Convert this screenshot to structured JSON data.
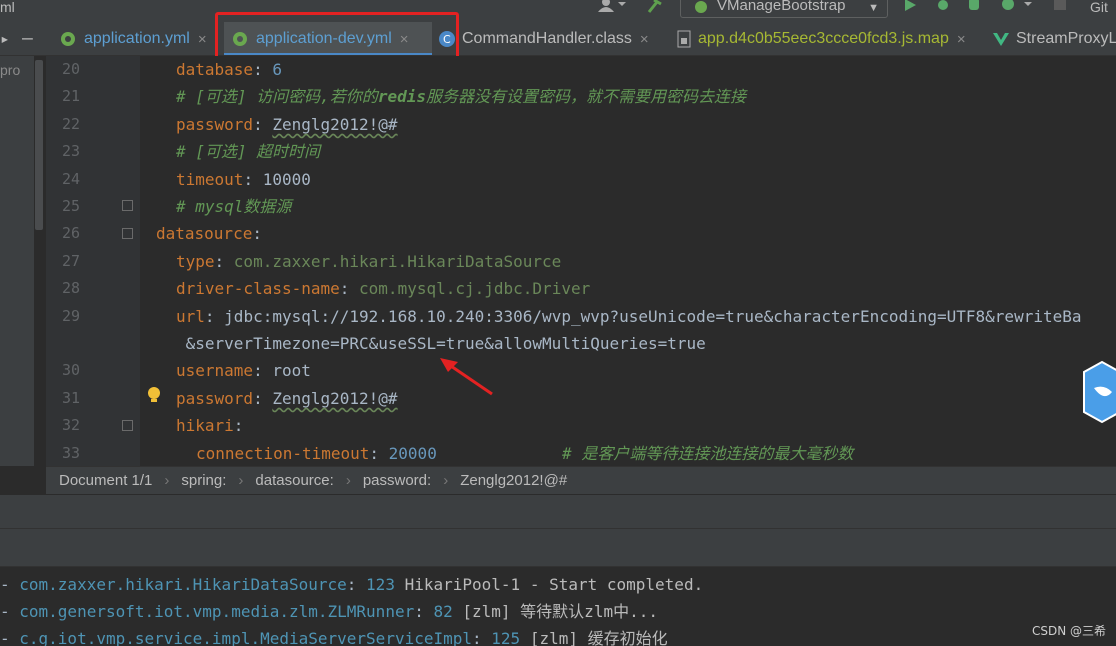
{
  "topbar": {
    "left_fragment": "ml",
    "run_config": "VManageBootstrap",
    "right_fragment": "Git"
  },
  "tabs": [
    {
      "label": "application.yml",
      "icon": "spring-leaf-icon",
      "active": false,
      "color": "#5d9fd2"
    },
    {
      "label": "application-dev.yml",
      "icon": "spring-leaf-icon",
      "active": true,
      "color": "#5d9fd2"
    },
    {
      "label": "CommandHandler.class",
      "icon": "class-icon",
      "active": false,
      "color": "#bbbbbb"
    },
    {
      "label": "app.d4c0b55eec3ccce0fcd3.js.map",
      "icon": "js-file-icon",
      "active": false,
      "color": "#a6b833"
    },
    {
      "label": "StreamProxyL",
      "icon": "vue-icon",
      "active": false,
      "color": "#bbbbbb"
    }
  ],
  "left_panel": {
    "fragment": "pro"
  },
  "editor": {
    "lines": [
      {
        "num": "20",
        "indent": 2,
        "tokens": [
          {
            "t": "database",
            "c": "k"
          },
          {
            "t": ": ",
            "c": "v"
          },
          {
            "t": "6",
            "c": "n"
          }
        ]
      },
      {
        "num": "21",
        "indent": 2,
        "tokens": [
          {
            "t": "# [可选] 访问密码,若你的",
            "c": "c"
          },
          {
            "t": "redis",
            "c": "cb"
          },
          {
            "t": "服务器没有设置密码，就不需要用密码去连接",
            "c": "c"
          }
        ]
      },
      {
        "num": "22",
        "indent": 2,
        "tokens": [
          {
            "t": "password",
            "c": "k"
          },
          {
            "t": ": ",
            "c": "v"
          },
          {
            "t": "Zenglg2012!@#",
            "c": "v sp"
          }
        ]
      },
      {
        "num": "23",
        "indent": 2,
        "tokens": [
          {
            "t": "# [可选] 超时时间",
            "c": "c"
          }
        ]
      },
      {
        "num": "24",
        "indent": 2,
        "tokens": [
          {
            "t": "timeout",
            "c": "k"
          },
          {
            "t": ": ",
            "c": "v"
          },
          {
            "t": "10000",
            "c": "v"
          }
        ]
      },
      {
        "num": "25",
        "indent": 2,
        "tokens": [
          {
            "t": "# mysql数据源",
            "c": "c"
          }
        ]
      },
      {
        "num": "26",
        "indent": 1,
        "tokens": [
          {
            "t": "datasource",
            "c": "k"
          },
          {
            "t": ":",
            "c": "v"
          }
        ]
      },
      {
        "num": "27",
        "indent": 2,
        "tokens": [
          {
            "t": "type",
            "c": "k"
          },
          {
            "t": ": ",
            "c": "v"
          },
          {
            "t": "com.zaxxer.hikari.HikariDataSource",
            "c": "s"
          }
        ]
      },
      {
        "num": "28",
        "indent": 2,
        "tokens": [
          {
            "t": "driver-class-name",
            "c": "k"
          },
          {
            "t": ": ",
            "c": "v"
          },
          {
            "t": "com.mysql.cj.jdbc.Driver",
            "c": "s"
          }
        ]
      },
      {
        "num": "29",
        "indent": 2,
        "tokens": [
          {
            "t": "url",
            "c": "k"
          },
          {
            "t": ": ",
            "c": "v"
          },
          {
            "t": "jdbc:mysql://192.168.10.240:3306/wvp_wvp?useUnicode=true&characterEncoding=UTF8&rewriteBa",
            "c": "v"
          }
        ]
      },
      {
        "num": "",
        "indent": 2,
        "tokens": [
          {
            "t": " &serverTimezone=PRC&useSSL=true&allowMultiQueries=true",
            "c": "v"
          }
        ]
      },
      {
        "num": "30",
        "indent": 2,
        "tokens": [
          {
            "t": "username",
            "c": "k"
          },
          {
            "t": ": ",
            "c": "v"
          },
          {
            "t": "root",
            "c": "v"
          }
        ]
      },
      {
        "num": "31",
        "indent": 2,
        "tokens": [
          {
            "t": "password",
            "c": "k"
          },
          {
            "t": ": ",
            "c": "v"
          },
          {
            "t": "Zenglg2012!@#",
            "c": "v sp"
          }
        ]
      },
      {
        "num": "32",
        "indent": 2,
        "tokens": [
          {
            "t": "hikari",
            "c": "k"
          },
          {
            "t": ":",
            "c": "v"
          }
        ]
      },
      {
        "num": "33",
        "indent": 3,
        "tokens": [
          {
            "t": "connection-timeout",
            "c": "k"
          },
          {
            "t": ": ",
            "c": "v"
          },
          {
            "t": "20000",
            "c": "n"
          },
          {
            "t": "             # 是客户端等待连接池连接的最大毫秒数",
            "c": "c"
          }
        ]
      }
    ]
  },
  "breadcrumb": [
    "Document 1/1",
    "spring:",
    "datasource:",
    "password:",
    "Zenglg2012!@#"
  ],
  "console": [
    {
      "dash": "- ",
      "cls": "com.zaxxer.hikari.HikariDataSource",
      "num": "123",
      "msg": " HikariPool-1 - Start completed."
    },
    {
      "dash": "- ",
      "cls": "com.genersoft.iot.vmp.media.zlm.ZLMRunner",
      "num": "82",
      "msg": " [zlm] 等待默认zlm中..."
    },
    {
      "dash": "- ",
      "cls": "c.g.iot.vmp.service.impl.MediaServerServiceImpl",
      "num": "125",
      "msg": " [zlm] 缓存初始化"
    }
  ],
  "watermark": "CSDN @三希",
  "colors": {
    "highlight": "#e32222",
    "arrow": "#e32222",
    "accent": "#4a88c7"
  }
}
